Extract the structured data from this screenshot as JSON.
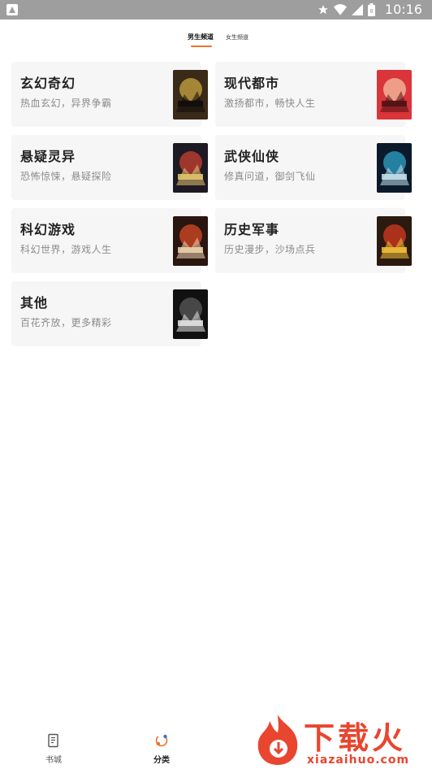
{
  "status_bar": {
    "time": "10:16"
  },
  "tabs": [
    {
      "label": "男生频道",
      "active": true
    },
    {
      "label": "女生频道",
      "active": false
    }
  ],
  "categories": [
    {
      "title": "玄幻奇幻",
      "subtitle": "热血玄幻，异界争霸",
      "cover_colors": [
        "#3a2a18",
        "#c9a441",
        "#0e0d0b"
      ]
    },
    {
      "title": "现代都市",
      "subtitle": "激扬都市，畅快人生",
      "cover_colors": [
        "#d9353a",
        "#f4c1a3",
        "#4a1014"
      ]
    },
    {
      "title": "悬疑灵异",
      "subtitle": "恐怖惊悚，悬疑探险",
      "cover_colors": [
        "#1e1a24",
        "#c84030",
        "#e8c870"
      ]
    },
    {
      "title": "武侠仙侠",
      "subtitle": "修真问道，御剑飞仙",
      "cover_colors": [
        "#0b1a2a",
        "#2fa3c8",
        "#c7e6f0"
      ]
    },
    {
      "title": "科幻游戏",
      "subtitle": "科幻世界，游戏人生",
      "cover_colors": [
        "#2a1610",
        "#d84a24",
        "#f0d6b0"
      ]
    },
    {
      "title": "历史军事",
      "subtitle": "历史漫步，沙场点兵",
      "cover_colors": [
        "#2a1a10",
        "#d63b20",
        "#f6c23a"
      ]
    },
    {
      "title": "其他",
      "subtitle": "百花齐放，更多精彩",
      "cover_colors": [
        "#111111",
        "#5a5a5a",
        "#e8e8e8"
      ]
    }
  ],
  "bottom_nav": [
    {
      "label": "书城",
      "icon": "book-icon",
      "active": false
    },
    {
      "label": "分类",
      "icon": "category-icon",
      "active": true
    }
  ],
  "watermark": {
    "brand": "下载火",
    "url": "xiazaihuo.com",
    "color": "#e8462f"
  },
  "colors": {
    "accent": "#e8742b",
    "card_bg": "#f6f6f6"
  }
}
